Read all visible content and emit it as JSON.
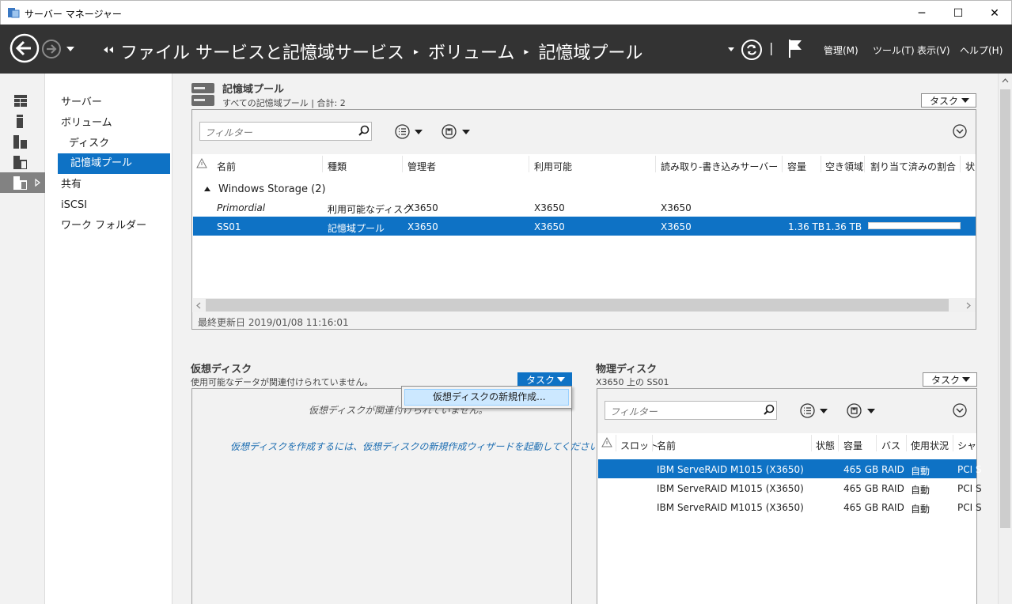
{
  "window": {
    "title": "サーバー マネージャー",
    "minimize": "─",
    "maximize": "☐",
    "close": "✕"
  },
  "header": {
    "back_arrow": "◀◀",
    "breadcrumb": [
      "ファイル サービスと記憶域サービス",
      "ボリューム",
      "記憶域プール"
    ],
    "separator": "▸",
    "menus": [
      "管理(M)",
      "ツール(T)",
      "表示(V)",
      "ヘルプ(H)"
    ],
    "pipe": "|"
  },
  "nav": {
    "items": [
      "サーバー",
      "ボリューム",
      "ディスク",
      "記憶域プール",
      "共有",
      "iSCSI",
      "ワーク フォルダー"
    ]
  },
  "pool_section": {
    "title": "記憶域プール",
    "subtitle": "すべての記憶域プール | 合計: 2",
    "task_label": "タスク",
    "filter_placeholder": "フィルター",
    "columns": [
      "名前",
      "種類",
      "管理者",
      "利用可能",
      "読み取り-書き込みサーバー",
      "容量",
      "空き領域",
      "割り当て済みの割合",
      "状"
    ],
    "group_label": "Windows Storage (2)",
    "rows": [
      {
        "name": "Primordial",
        "type": "利用可能なディスク",
        "admin": "X3650",
        "available": "X3650",
        "rw_server": "X3650",
        "capacity": "",
        "free": "",
        "allocated_percent": null
      },
      {
        "name": "SS01",
        "type": "記憶域プール",
        "admin": "X3650",
        "available": "X3650",
        "rw_server": "X3650",
        "capacity": "1.36 TB",
        "free": "1.36 TB",
        "allocated_percent": 0
      }
    ],
    "last_updated": "最終更新日 2019/01/08 11:16:01"
  },
  "vdisk_section": {
    "title": "仮想ディスク",
    "subtitle": "使用可能なデータが関連付けられていません。",
    "task_label": "タスク",
    "empty_message": "仮想ディスクが関連付けられていません。",
    "hint_message": "仮想ディスクを作成するには、仮想ディスクの新規作成ウィザードを起動してください。",
    "menu_item": "仮想ディスクの新規作成..."
  },
  "pdisk_section": {
    "title": "物理ディスク",
    "subtitle": "X3650 上の SS01",
    "task_label": "タスク",
    "filter_placeholder": "フィルター",
    "columns": [
      "スロット",
      "名前",
      "状態",
      "容量",
      "バス",
      "使用状況",
      "シャ"
    ],
    "rows": [
      {
        "slot": "",
        "name": "IBM ServeRAID M1015 (X3650)",
        "status": "",
        "capacity": "465 GB",
        "bus": "RAID",
        "usage": "自動",
        "chassis": "PCI S"
      },
      {
        "slot": "",
        "name": "IBM ServeRAID M1015 (X3650)",
        "status": "",
        "capacity": "465 GB",
        "bus": "RAID",
        "usage": "自動",
        "chassis": "PCI S"
      },
      {
        "slot": "",
        "name": "IBM ServeRAID M1015 (X3650)",
        "status": "",
        "capacity": "465 GB",
        "bus": "RAID",
        "usage": "自動",
        "chassis": "PCI S"
      }
    ]
  },
  "colors": {
    "accent": "#0e72c5",
    "header_bg": "#333333"
  }
}
